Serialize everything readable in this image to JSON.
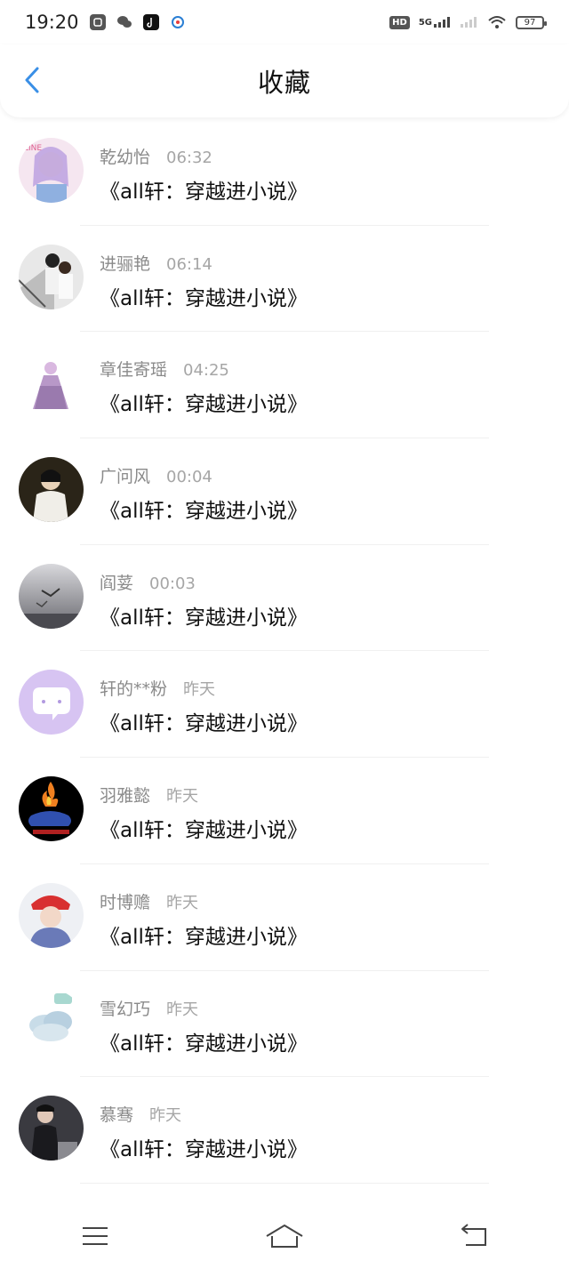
{
  "status_bar": {
    "time": "19:20",
    "network": "5G",
    "battery": "97",
    "hd": "HD"
  },
  "header": {
    "title": "收藏",
    "back_icon": "chevron-left-icon"
  },
  "colors": {
    "accent": "#3a8fe6"
  },
  "items": [
    {
      "name": "乾幼怡",
      "time": "06:32",
      "book": "《all轩：穿越进小说》",
      "avatar": "anime-girl"
    },
    {
      "name": "进骊艳",
      "time": "06:14",
      "book": "《all轩：穿越进小说》",
      "avatar": "couple-photo"
    },
    {
      "name": "章佳寄瑶",
      "time": "04:25",
      "book": "《all轩：穿越进小说》",
      "avatar": "princess-dress"
    },
    {
      "name": "广问风",
      "time": "00:04",
      "book": "《all轩：穿越进小说》",
      "avatar": "woman-portrait"
    },
    {
      "name": "阎荽",
      "time": "00:03",
      "book": "《all轩：穿越进小说》",
      "avatar": "birds-sea"
    },
    {
      "name": "轩的**粉",
      "time": "昨天",
      "book": "《all轩：穿越进小说》",
      "avatar": "chat-bubble"
    },
    {
      "name": "羽雅懿",
      "time": "昨天",
      "book": "《all轩：穿越进小说》",
      "avatar": "fire-whale"
    },
    {
      "name": "时博赡",
      "time": "昨天",
      "book": "《all轩：穿越进小说》",
      "avatar": "red-hat-boy"
    },
    {
      "name": "雪幻巧",
      "time": "昨天",
      "book": "《all轩：穿越进小说》",
      "avatar": "clouds"
    },
    {
      "name": "慕骞",
      "time": "昨天",
      "book": "《all轩：穿越进小说》",
      "avatar": "man-in-dark"
    }
  ],
  "nav_bar": {
    "menu_icon": "menu-icon",
    "home_icon": "home-icon",
    "back_icon": "back-icon"
  }
}
